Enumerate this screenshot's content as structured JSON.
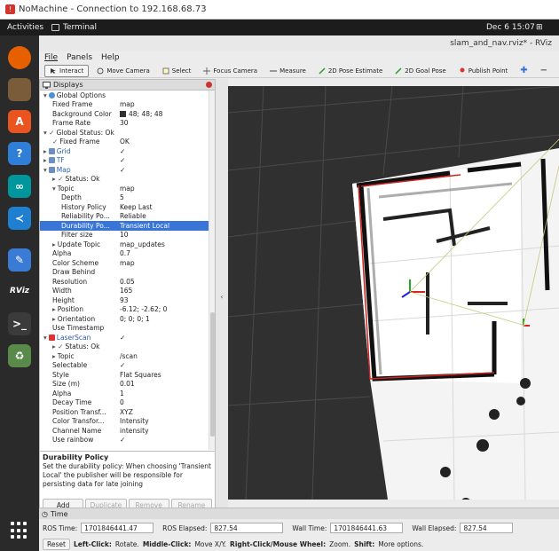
{
  "nx_bar": {
    "title": "NoMachine - Connection to 192.168.68.73"
  },
  "gnome": {
    "activities": "Activities",
    "app": "Terminal",
    "clock": "Dec 6  15:07"
  },
  "dock": {
    "items": [
      {
        "name": "firefox-icon",
        "color": "#e66000",
        "glyph": ""
      },
      {
        "name": "files-icon",
        "color": "#7a5c3a",
        "glyph": ""
      },
      {
        "name": "software-store-icon",
        "color": "#e95420",
        "glyph": "A"
      },
      {
        "name": "help-icon",
        "color": "#2f7fd8",
        "glyph": "?"
      },
      {
        "name": "arduino-icon",
        "color": "#00979c",
        "glyph": "∞"
      },
      {
        "name": "vscode-icon",
        "color": "#1f7fd0",
        "glyph": "≺"
      },
      {
        "name": "text-editor-icon",
        "color": "#3a7bd5",
        "glyph": "✎"
      },
      {
        "name": "rviz-icon",
        "color": "#2a2a2a",
        "glyph": "RViz"
      },
      {
        "name": "terminal-icon",
        "color": "#3b3b3b",
        "glyph": ">_"
      },
      {
        "name": "trash-icon",
        "color": "#5a8a4a",
        "glyph": "♻"
      }
    ]
  },
  "window": {
    "title": "slam_and_nav.rviz* - RViz"
  },
  "menu": {
    "file": "File",
    "panels": "Panels",
    "help": "Help"
  },
  "toolbar": {
    "interact": "Interact",
    "move_camera": "Move Camera",
    "select": "Select",
    "focus_camera": "Focus Camera",
    "measure": "Measure",
    "pose_estimate": "2D Pose Estimate",
    "goal_pose": "2D Goal Pose",
    "publish_point": "Publish Point"
  },
  "displays": {
    "title": "Displays",
    "rows": [
      {
        "label": "Global Options",
        "value": "",
        "indent": 1,
        "prefix": "▾",
        "style": "",
        "icon": "globe"
      },
      {
        "label": "Fixed Frame",
        "value": "map",
        "indent": 2
      },
      {
        "label": "Background Color",
        "value": "48; 48; 48",
        "indent": 2,
        "swatch": "#303030"
      },
      {
        "label": "Frame Rate",
        "value": "30",
        "indent": 2
      },
      {
        "label": "Global Status: Ok",
        "value": "",
        "indent": 1,
        "prefix": "▾ ✓"
      },
      {
        "label": "Fixed Frame",
        "value": "OK",
        "indent": 2,
        "prefix": "✓"
      },
      {
        "label": "Grid",
        "value": "✓",
        "indent": 1,
        "prefix": "▸",
        "style": "blue",
        "icon": "grid"
      },
      {
        "label": "TF",
        "value": "✓",
        "indent": 1,
        "prefix": "▸",
        "style": "blue",
        "icon": "tf"
      },
      {
        "label": "Map",
        "value": "✓",
        "indent": 1,
        "prefix": "▾",
        "style": "blue",
        "icon": "map"
      },
      {
        "label": "Status: Ok",
        "value": "",
        "indent": 2,
        "prefix": "▸ ✓"
      },
      {
        "label": "Topic",
        "value": "map",
        "indent": 2,
        "prefix": "▾"
      },
      {
        "label": "Depth",
        "value": "5",
        "indent": 3
      },
      {
        "label": "History Policy",
        "value": "Keep Last",
        "indent": 3
      },
      {
        "label": "Reliability Po...",
        "value": "Reliable",
        "indent": 3
      },
      {
        "label": "Durability Po...",
        "value": "Transient Local",
        "indent": 3,
        "selected": true
      },
      {
        "label": "Filter size",
        "value": "10",
        "indent": 3
      },
      {
        "label": "Update Topic",
        "value": "map_updates",
        "indent": 2,
        "prefix": "▸"
      },
      {
        "label": "Alpha",
        "value": "0.7",
        "indent": 2
      },
      {
        "label": "Color Scheme",
        "value": "map",
        "indent": 2
      },
      {
        "label": "Draw Behind",
        "value": "",
        "indent": 2
      },
      {
        "label": "Resolution",
        "value": "0.05",
        "indent": 2
      },
      {
        "label": "Width",
        "value": "165",
        "indent": 2
      },
      {
        "label": "Height",
        "value": "93",
        "indent": 2
      },
      {
        "label": "Position",
        "value": "-6.12; -2.62; 0",
        "indent": 2,
        "prefix": "▸"
      },
      {
        "label": "Orientation",
        "value": "0; 0; 0; 1",
        "indent": 2,
        "prefix": "▸"
      },
      {
        "label": "Use Timestamp",
        "value": "",
        "indent": 2
      },
      {
        "label": "LaserScan",
        "value": "✓",
        "indent": 1,
        "prefix": "▾",
        "style": "blue",
        "icon": "laser"
      },
      {
        "label": "Status: Ok",
        "value": "",
        "indent": 2,
        "prefix": "▸ ✓"
      },
      {
        "label": "Topic",
        "value": "/scan",
        "indent": 2,
        "prefix": "▸"
      },
      {
        "label": "Selectable",
        "value": "✓",
        "indent": 2
      },
      {
        "label": "Style",
        "value": "Flat Squares",
        "indent": 2
      },
      {
        "label": "Size (m)",
        "value": "0.01",
        "indent": 2
      },
      {
        "label": "Alpha",
        "value": "1",
        "indent": 2
      },
      {
        "label": "Decay Time",
        "value": "0",
        "indent": 2
      },
      {
        "label": "Position Transf...",
        "value": "XYZ",
        "indent": 2
      },
      {
        "label": "Color Transfor...",
        "value": "Intensity",
        "indent": 2
      },
      {
        "label": "Channel Name",
        "value": "intensity",
        "indent": 2
      },
      {
        "label": "Use rainbow",
        "value": "✓",
        "indent": 2
      }
    ],
    "desc_title": "Durability Policy",
    "desc_text": "Set the durability policy: When choosing 'Transient Local' the publisher will be responsible for persisting data for late joining",
    "buttons": {
      "add": "Add",
      "duplicate": "Duplicate",
      "remove": "Remove",
      "rename": "Rename"
    }
  },
  "time": {
    "title": "Time",
    "ros_time_label": "ROS Time:",
    "ros_time": "1701846441.47",
    "ros_elapsed_label": "ROS Elapsed:",
    "ros_elapsed": "827.54",
    "wall_time_label": "Wall Time:",
    "wall_time": "1701846441.63",
    "wall_elapsed_label": "Wall Elapsed:",
    "wall_elapsed": "827.54",
    "reset": "Reset",
    "hint_left_bold": "Left-Click:",
    "hint_left": "Rotate.",
    "hint_middle_bold": "Middle-Click:",
    "hint_middle": "Move X/Y.",
    "hint_right_bold": "Right-Click/Mouse Wheel:",
    "hint_right": "Zoom.",
    "hint_shift_bold": "Shift:",
    "hint_shift": "More options."
  }
}
